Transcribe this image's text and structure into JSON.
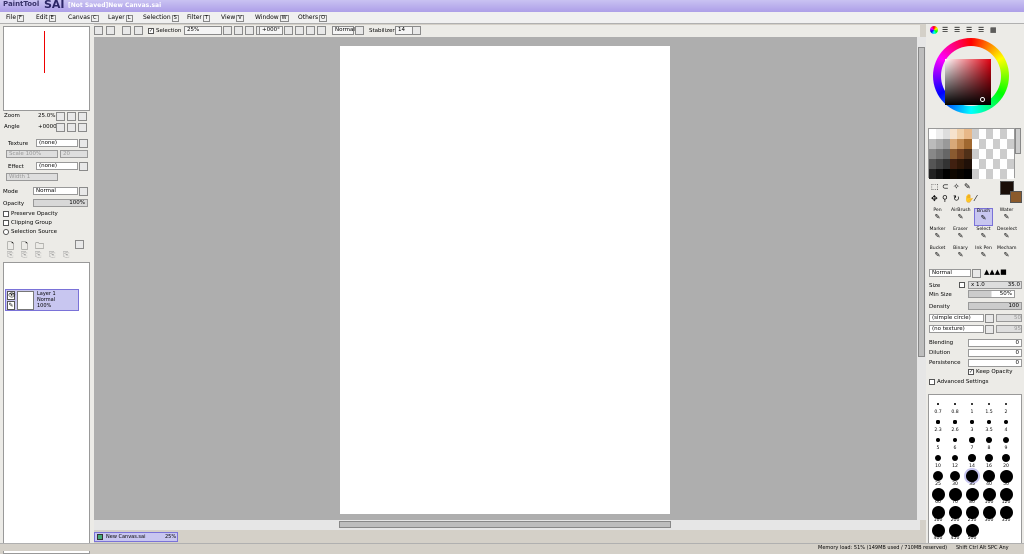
{
  "window": {
    "app_logo": "PaintTool",
    "app_name": "SAI",
    "doc_title": "[Not Saved]New Canvas.sai"
  },
  "menu": [
    {
      "label": "File",
      "key": "F"
    },
    {
      "label": "Edit",
      "key": "E"
    },
    {
      "label": "Canvas",
      "key": "C"
    },
    {
      "label": "Layer",
      "key": "L"
    },
    {
      "label": "Selection",
      "key": "S"
    },
    {
      "label": "Filter",
      "key": "T"
    },
    {
      "label": "View",
      "key": "V"
    },
    {
      "label": "Window",
      "key": "W"
    },
    {
      "label": "Others",
      "key": "O"
    }
  ],
  "toolbar": {
    "selection_label": "Selection",
    "zoom_value": "25%",
    "angle_value": "+000°",
    "blend_mode": "Normal",
    "stabilizer_label": "Stabilizer",
    "stabilizer_value": "14"
  },
  "navigator": {
    "zoom_label": "Zoom",
    "zoom_value": "25.0%",
    "angle_label": "Angle",
    "angle_value": "+0000"
  },
  "layer_panel": {
    "texture_label": "Texture",
    "texture_value": "(none)",
    "texture_scale": "Scale",
    "texture_scale_value": "100%",
    "texture_extra": "20",
    "effect_label": "Effect",
    "effect_value": "(none)",
    "effect_width": "Width",
    "effect_width_value": "1",
    "mode_label": "Mode",
    "mode_value": "Normal",
    "opacity_label": "Opacity",
    "opacity_value": "100%",
    "preserve_opacity": "Preserve Opacity",
    "clipping_group": "Clipping Group",
    "selection_source": "Selection Source",
    "layer_name": "Layer 1",
    "layer_mode": "Normal",
    "layer_opacity": "100%"
  },
  "tabs": {
    "doc_name": "New Canvas.sai",
    "doc_zoom": "25%"
  },
  "status": {
    "memory": "Memory load: 51% (149MB used / 710MB reserved)",
    "keys": "Shift Ctrl Alt SPC Any"
  },
  "colors": {
    "accent": "#c8c6f0",
    "primary_color": "#1a0e08",
    "secondary_color": "#8b5a2b"
  },
  "tools": [
    {
      "label": "Pen"
    },
    {
      "label": "AirBrush"
    },
    {
      "label": "Brush"
    },
    {
      "label": "Water"
    },
    {
      "label": "Marker"
    },
    {
      "label": "Eraser"
    },
    {
      "label": "Select"
    },
    {
      "label": "Deselect"
    },
    {
      "label": "Bucket"
    },
    {
      "label": "Binary"
    },
    {
      "label": "Ink Pen"
    },
    {
      "label": "Mecham"
    }
  ],
  "brush": {
    "mode": "Normal",
    "size_label": "Size",
    "size_mult": "x 1.0",
    "size_value": "35.0",
    "min_size_label": "Min Size",
    "min_size_value": "50%",
    "density_label": "Density",
    "density_value": "100",
    "shape": "(simple circle)",
    "shape_value": "50",
    "texture": "(no texture)",
    "texture_value": "95",
    "blending_label": "Blending",
    "blending_value": "0",
    "dilution_label": "Dilution",
    "dilution_value": "0",
    "persistence_label": "Persistence",
    "persistence_value": "0",
    "keep_opacity": "Keep Opacity",
    "advanced": "Advanced Settings"
  },
  "brush_sizes": [
    "0.7",
    "0.8",
    "1",
    "1.5",
    "2",
    "2.3",
    "2.6",
    "3",
    "3.5",
    "4",
    "5",
    "6",
    "7",
    "8",
    "9",
    "10",
    "12",
    "14",
    "16",
    "20",
    "25",
    "30",
    "35",
    "40",
    "50",
    "60",
    "70",
    "80",
    "100",
    "120",
    "160",
    "200",
    "250",
    "300",
    "350",
    "400",
    "450",
    "500"
  ]
}
